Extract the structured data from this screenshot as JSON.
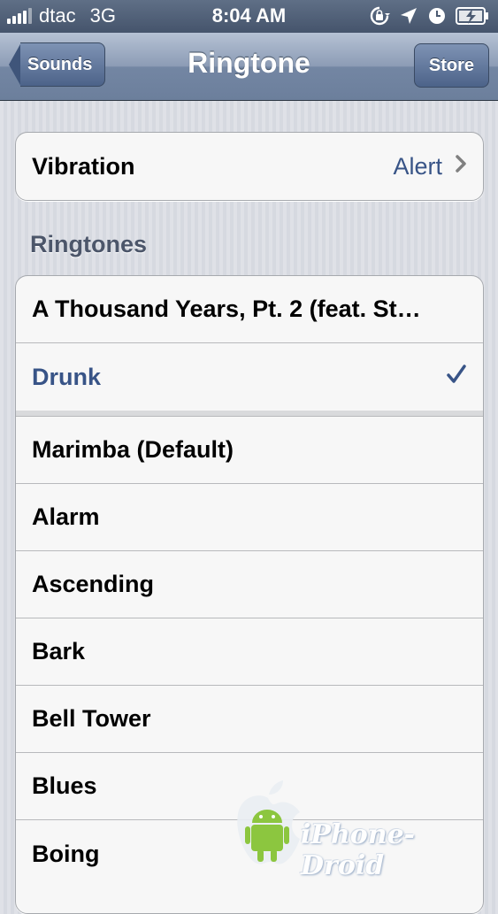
{
  "status_bar": {
    "carrier": "dtac",
    "network": "3G",
    "time": "8:04 AM",
    "icons": [
      "rotation-lock-icon",
      "location-icon",
      "alarm-icon",
      "battery-charging-icon"
    ]
  },
  "nav": {
    "back_label": "Sounds",
    "title": "Ringtone",
    "store_label": "Store"
  },
  "vibration": {
    "label": "Vibration",
    "value": "Alert"
  },
  "section_header": "Ringtones",
  "ringtones": {
    "purchased": [
      {
        "label": "A Thousand Years, Pt. 2 (feat. St…",
        "selected": false
      },
      {
        "label": "Drunk",
        "selected": true
      }
    ],
    "builtin": [
      "Marimba (Default)",
      "Alarm",
      "Ascending",
      "Bark",
      "Bell Tower",
      "Blues",
      "Boing"
    ]
  },
  "watermark": {
    "text": "iPhone-Droid"
  },
  "colors": {
    "accent": "#385487",
    "nav_bar": "#7386a3"
  }
}
